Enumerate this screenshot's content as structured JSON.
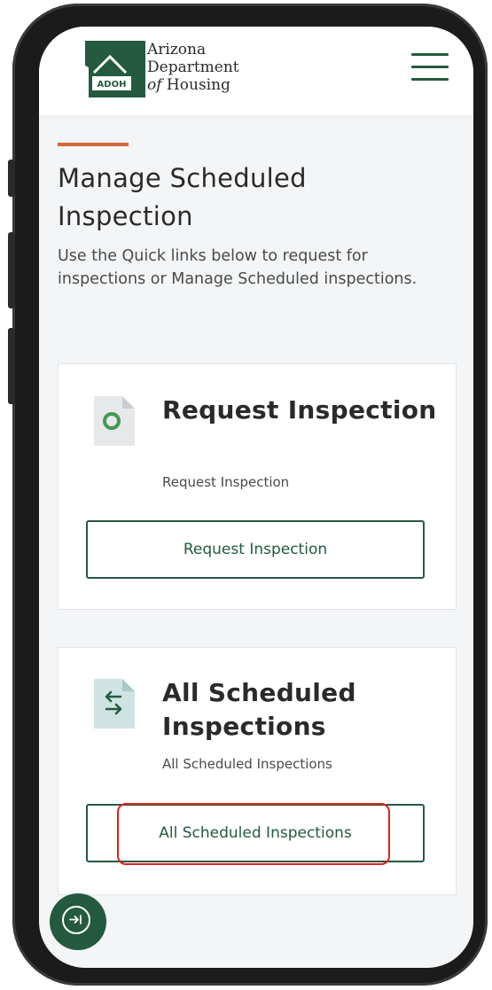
{
  "header": {
    "logo": {
      "badge_text": "ADOH",
      "line1": "Arizona",
      "line2": "Department",
      "line3_italic": "of",
      "line3_rest": " Housing"
    },
    "menu_icon": "hamburger-menu-icon"
  },
  "page": {
    "title": "Manage Scheduled Inspection",
    "description": "Use the Quick links below to request for inspections or Manage Scheduled inspections."
  },
  "cards": [
    {
      "icon": "document-circle-icon",
      "title": "Request Inspection",
      "subtitle": "Request Inspection",
      "button_label": "Request Inspection"
    },
    {
      "icon": "document-swap-icon",
      "title": "All Scheduled Inspections",
      "subtitle": "All Scheduled Inspections",
      "button_label": "All Scheduled Inspections"
    }
  ],
  "floating_button": {
    "icon": "collapse-arrow-icon"
  },
  "colors": {
    "brand_green": "#245a3f",
    "accent_orange": "#d36a3c",
    "highlight_red": "#e02020",
    "page_background": "#f3f5f7"
  }
}
